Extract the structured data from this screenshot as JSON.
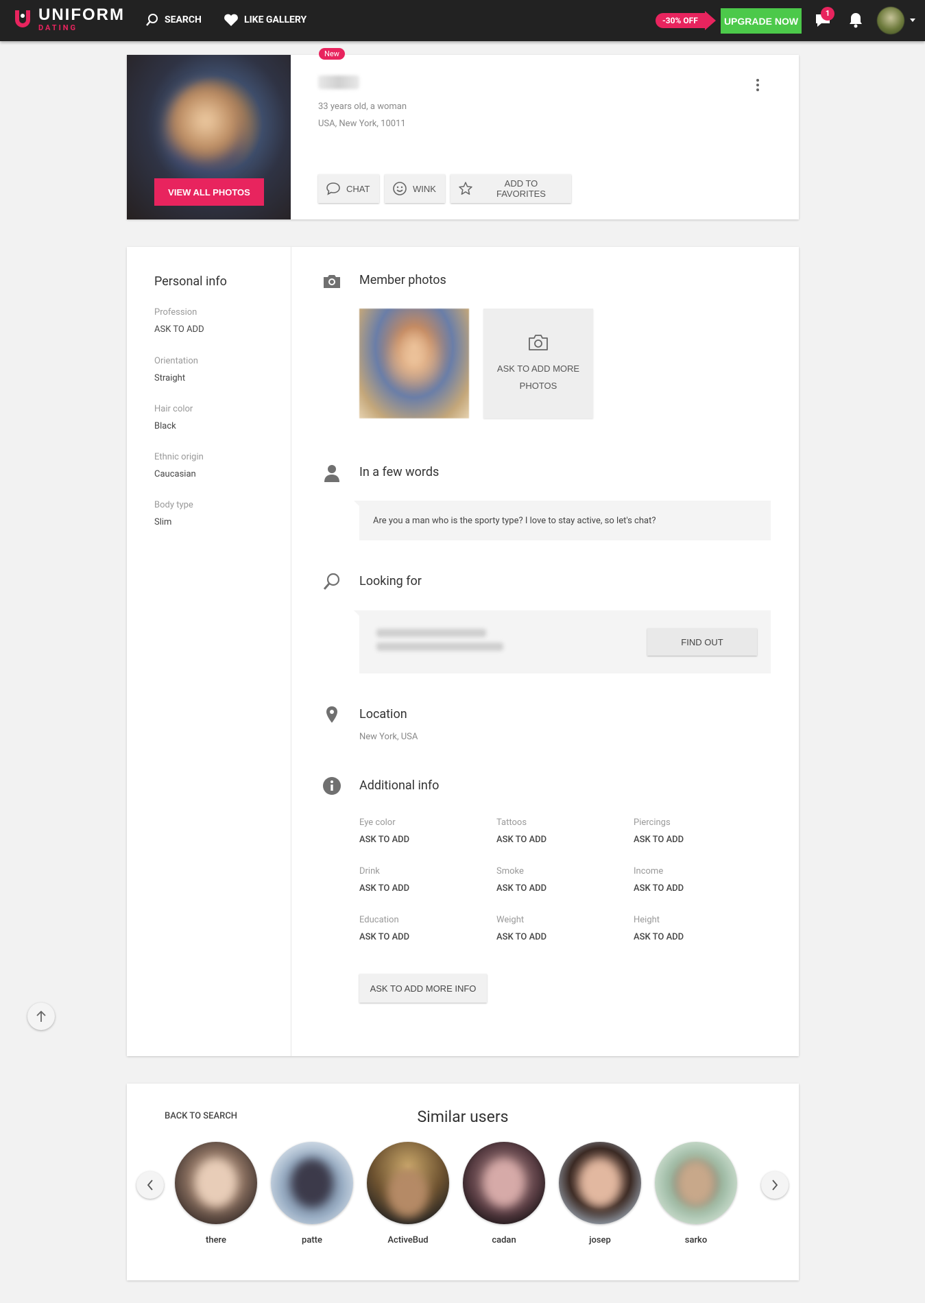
{
  "brand": {
    "name": "UNIFORM",
    "sub": "DATING",
    "accent": "#e8245e"
  },
  "nav": {
    "search": "SEARCH",
    "like_gallery": "LIKE GALLERY"
  },
  "promo": {
    "discount": "-30% OFF",
    "upgrade": "UPGRADE NOW",
    "upgrade_color": "#4cc94a"
  },
  "notifications": {
    "messages_count": "1"
  },
  "profile": {
    "new_badge": "New",
    "age_gender": "33 years old, a woman",
    "location": "USA, New York, 10011",
    "view_photos": "VIEW ALL PHOTOS",
    "actions": {
      "chat": "CHAT",
      "wink": "WINK",
      "favorites": "ADD TO FAVORITES"
    }
  },
  "personal_info": {
    "title": "Personal info",
    "items": [
      {
        "label": "Profession",
        "value": "ASK TO ADD"
      },
      {
        "label": "Orientation",
        "value": "Straight"
      },
      {
        "label": "Hair color",
        "value": "Black"
      },
      {
        "label": "Ethnic origin",
        "value": "Caucasian"
      },
      {
        "label": "Body type",
        "value": "Slim"
      }
    ]
  },
  "sections": {
    "photos": {
      "title": "Member photos",
      "ask_more_line1": "ASK TO ADD MORE",
      "ask_more_line2": "PHOTOS"
    },
    "about": {
      "title": "In a few words",
      "text": "Are you a man who is the sporty type? I love to stay active, so let's chat?"
    },
    "looking": {
      "title": "Looking for",
      "button": "FIND OUT"
    },
    "location": {
      "title": "Location",
      "text": "New York, USA"
    },
    "additional": {
      "title": "Additional info",
      "items": [
        {
          "label": "Eye color",
          "value": "ASK TO ADD"
        },
        {
          "label": "Tattoos",
          "value": "ASK TO ADD"
        },
        {
          "label": "Piercings",
          "value": "ASK TO ADD"
        },
        {
          "label": "Drink",
          "value": "ASK TO ADD"
        },
        {
          "label": "Smoke",
          "value": "ASK TO ADD"
        },
        {
          "label": "Income",
          "value": "ASK TO ADD"
        },
        {
          "label": "Education",
          "value": "ASK TO ADD"
        },
        {
          "label": "Weight",
          "value": "ASK TO ADD"
        },
        {
          "label": "Height",
          "value": "ASK TO ADD"
        }
      ],
      "more_button": "ASK TO ADD MORE INFO"
    }
  },
  "similar": {
    "back": "BACK TO SEARCH",
    "title": "Similar users",
    "users": [
      {
        "name": "there"
      },
      {
        "name": "patte"
      },
      {
        "name": "ActiveBud"
      },
      {
        "name": "cadan"
      },
      {
        "name": "josep"
      },
      {
        "name": "sarko"
      }
    ]
  }
}
